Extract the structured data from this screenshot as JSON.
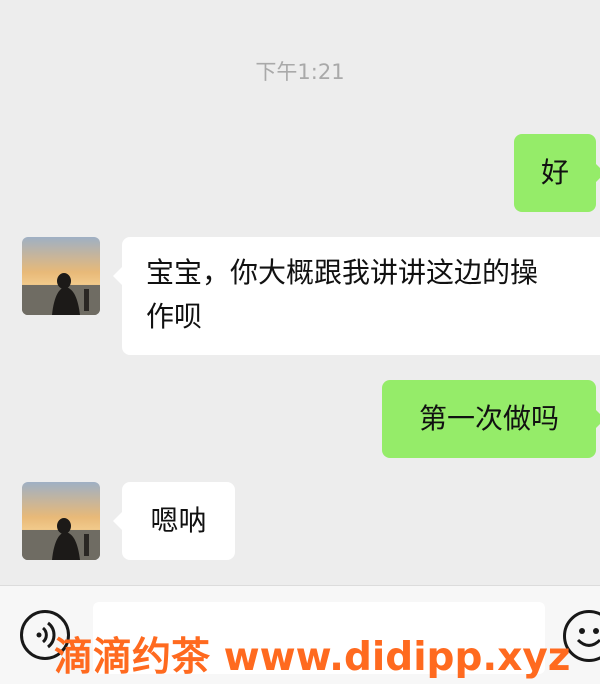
{
  "timestamp": "下午1:21",
  "messages": [
    {
      "side": "out",
      "text": "好"
    },
    {
      "side": "in",
      "line1": "宝宝，你大概跟我讲讲这边的操",
      "line2": "作呗"
    },
    {
      "side": "out",
      "text": "第一次做吗"
    },
    {
      "side": "in",
      "text": "嗯呐"
    }
  ],
  "watermark": "滴滴约茶 www.didipp.xyz",
  "colors": {
    "background": "#ededed",
    "incoming": "#ffffff",
    "outgoing": "#95ec69",
    "watermark": "#ff6a1f"
  },
  "icons": {
    "voice": "voice-icon",
    "emoji": "emoji-icon"
  }
}
